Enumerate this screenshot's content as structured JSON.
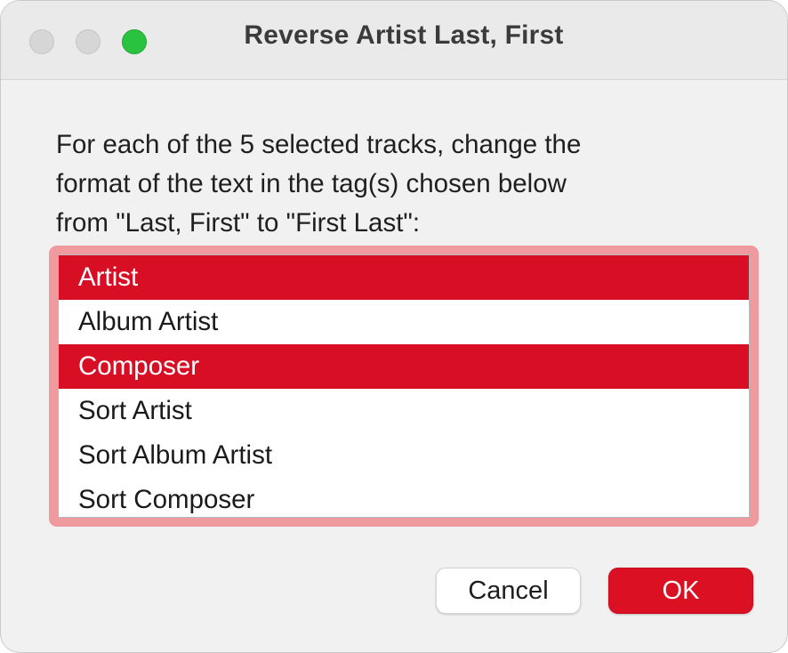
{
  "window": {
    "title": "Reverse Artist Last, First"
  },
  "message": {
    "lines": [
      "For each of the 5 selected tracks, change the",
      "format of the text in the tag(s) chosen below",
      "from \"Last, First\" to \"First Last\":"
    ]
  },
  "tag_list": {
    "items": [
      {
        "label": "Artist",
        "selected": true
      },
      {
        "label": "Album Artist",
        "selected": false
      },
      {
        "label": "Composer",
        "selected": true
      },
      {
        "label": "Sort Artist",
        "selected": false
      },
      {
        "label": "Sort Album Artist",
        "selected": false
      },
      {
        "label": "Sort Composer",
        "selected": false
      }
    ]
  },
  "buttons": {
    "cancel_label": "Cancel",
    "ok_label": "OK"
  },
  "colors": {
    "accent": "#d80e25",
    "focus_ring": "#ee9a9e",
    "zoom_button": "#2ac33f"
  },
  "icons": {
    "close": "close-traffic-light-icon",
    "minimize": "minimize-traffic-light-icon",
    "zoom": "zoom-traffic-light-icon"
  }
}
